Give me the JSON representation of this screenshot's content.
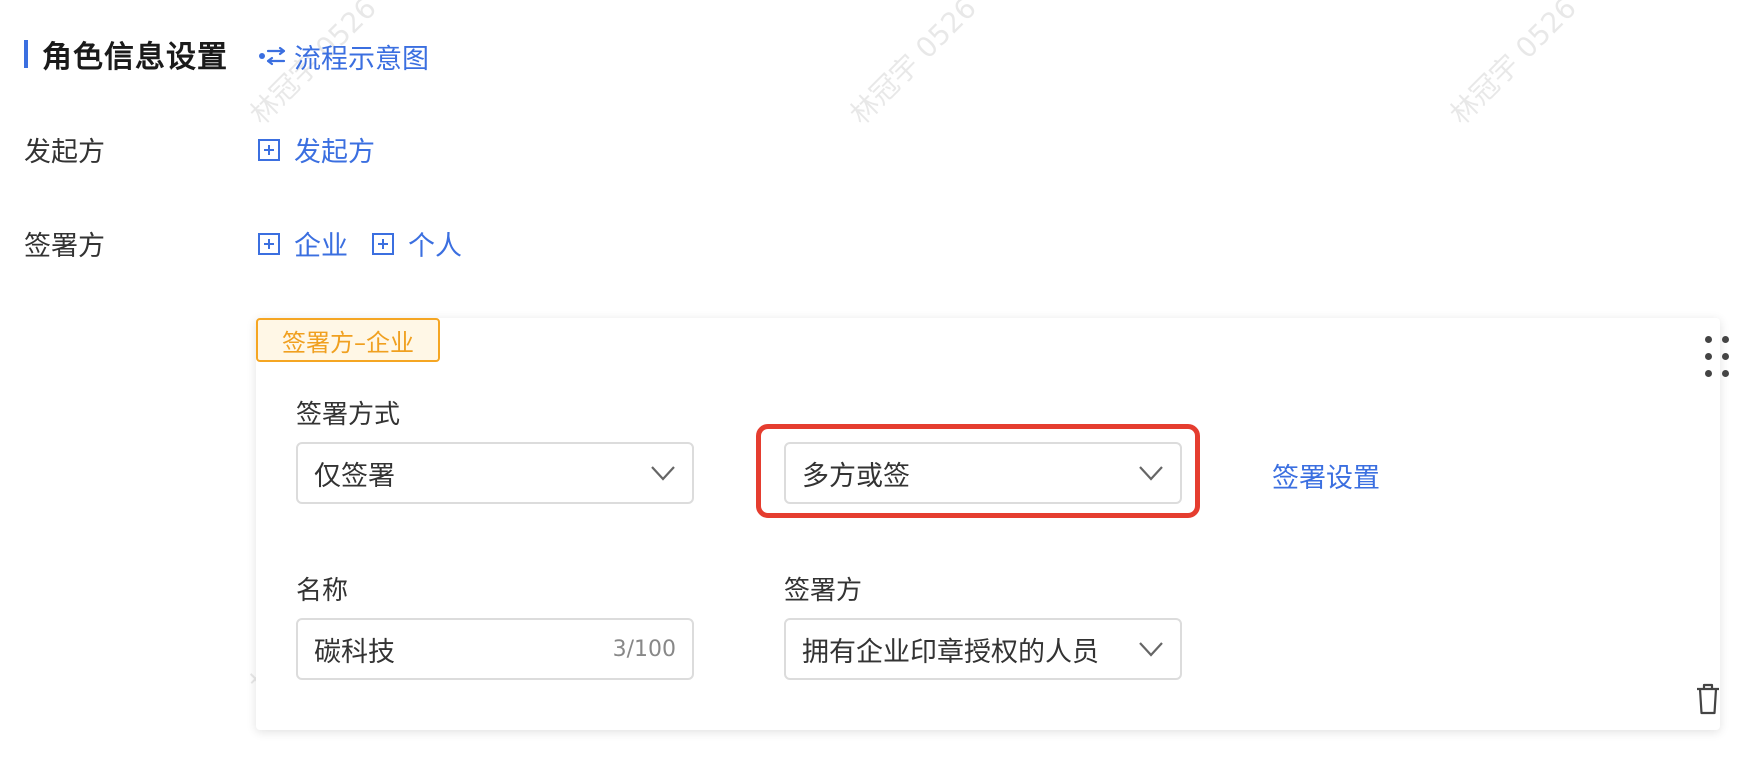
{
  "section": {
    "title": "角色信息设置",
    "flow_link": "流程示意图"
  },
  "initiator": {
    "label": "发起方",
    "add_label": "发起方"
  },
  "signer": {
    "label": "签署方",
    "add_enterprise": "企业",
    "add_personal": "个人"
  },
  "card": {
    "tag": "签署方–企业",
    "sign_method": {
      "label": "签署方式",
      "value": "仅签署"
    },
    "multi_sign": {
      "value": "多方或签"
    },
    "settings_link": "签署设置",
    "name": {
      "label": "名称",
      "value": "碳科技",
      "count": "3/100"
    },
    "signer_party": {
      "label": "签署方",
      "value": "拥有企业印章授权的人员"
    }
  },
  "watermark": "林冠宇 0526",
  "colors": {
    "accent": "#3b6fe0",
    "tag": "#f0a020",
    "highlight": "#e53d2f"
  }
}
